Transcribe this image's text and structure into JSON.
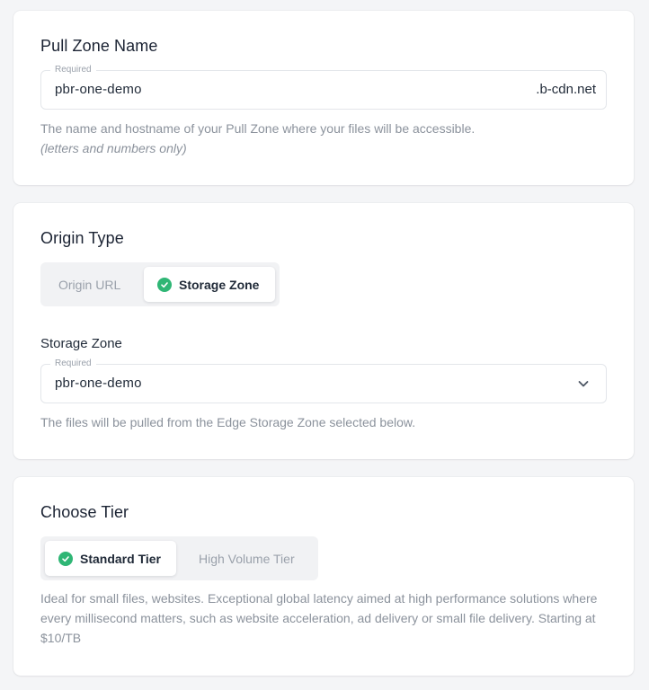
{
  "pull_zone": {
    "title": "Pull Zone Name",
    "field_label": "Required",
    "value": "pbr-one-demo",
    "suffix": ".b-cdn.net",
    "helper": "The name and hostname of your Pull Zone where your files will be accessible.",
    "helper_note": "(letters and numbers only)"
  },
  "origin": {
    "title": "Origin Type",
    "options": [
      {
        "label": "Origin URL",
        "selected": false
      },
      {
        "label": "Storage Zone",
        "selected": true
      }
    ],
    "storage_zone": {
      "label": "Storage Zone",
      "field_label": "Required",
      "value": "pbr-one-demo",
      "helper": "The files will be pulled from the Edge Storage Zone selected below."
    }
  },
  "tier": {
    "title": "Choose Tier",
    "options": [
      {
        "label": "Standard Tier",
        "selected": true
      },
      {
        "label": "High Volume Tier",
        "selected": false
      }
    ],
    "description": "Ideal for small files, websites. Exceptional global latency aimed at high performance solutions where every millisecond matters, such as website acceleration, ad delivery or small file delivery. Starting at $10/TB"
  },
  "colors": {
    "accent_green": "#2fb675",
    "page_bg": "#f4f5f7",
    "card_bg": "#ffffff",
    "muted_text": "#8b929c"
  },
  "icons": {
    "check": "check-circle-icon",
    "dropdown": "chevron-down-icon"
  }
}
